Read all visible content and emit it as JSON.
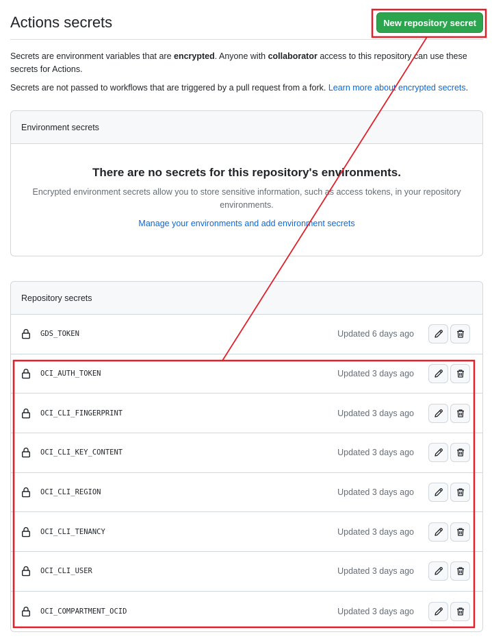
{
  "header": {
    "title": "Actions secrets",
    "new_secret_label": "New repository secret"
  },
  "intro": {
    "p1_a": "Secrets are environment variables that are ",
    "p1_b": "encrypted",
    "p1_c": ". Anyone with ",
    "p1_d": "collaborator",
    "p1_e": " access to this repository can use these secrets for Actions.",
    "p2_a": "Secrets are not passed to workflows that are triggered by a pull request from a fork. ",
    "p2_link": "Learn more about encrypted secrets",
    "p2_end": "."
  },
  "environment": {
    "header": "Environment secrets",
    "blank_title": "There are no secrets for this repository's environments.",
    "blank_desc": "Encrypted environment secrets allow you to store sensitive information, such as access tokens, in your repository environments.",
    "manage_link": "Manage your environments and add environment secrets"
  },
  "repository": {
    "header": "Repository secrets",
    "secrets": [
      {
        "name": "GDS_TOKEN",
        "updated": "Updated 6 days ago"
      },
      {
        "name": "OCI_AUTH_TOKEN",
        "updated": "Updated 3 days ago"
      },
      {
        "name": "OCI_CLI_FINGERPRINT",
        "updated": "Updated 3 days ago"
      },
      {
        "name": "OCI_CLI_KEY_CONTENT",
        "updated": "Updated 3 days ago"
      },
      {
        "name": "OCI_CLI_REGION",
        "updated": "Updated 3 days ago"
      },
      {
        "name": "OCI_CLI_TENANCY",
        "updated": "Updated 3 days ago"
      },
      {
        "name": "OCI_CLI_USER",
        "updated": "Updated 3 days ago"
      },
      {
        "name": "OCI_COMPARTMENT_OCID",
        "updated": "Updated 3 days ago"
      }
    ]
  },
  "icons": {
    "lock": "lock-icon",
    "edit": "pencil-icon",
    "delete": "trash-icon"
  },
  "colors": {
    "primary_button": "#2da44e",
    "link": "#0969da",
    "annotation": "#e0202a"
  }
}
